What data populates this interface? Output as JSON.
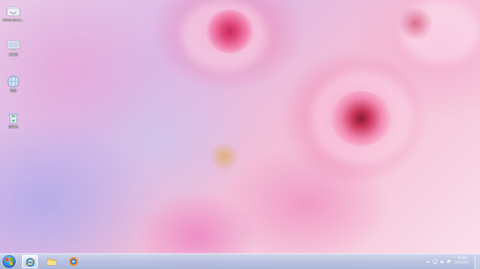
{
  "desktop": {
    "icons": [
      {
        "label": "Administrat...",
        "icon": "user-folder-icon"
      },
      {
        "label": "计算机",
        "icon": "computer-icon"
      },
      {
        "label": "网络",
        "icon": "network-globe-icon"
      },
      {
        "label": "回收站",
        "icon": "recycle-bin-icon"
      }
    ]
  },
  "taskbar": {
    "start": {
      "icon": "windows-start-orb-icon"
    },
    "pinned": [
      {
        "name": "ie-browser",
        "icon": "internet-explorer-icon",
        "active": true
      },
      {
        "name": "file-explorer",
        "icon": "folder-icon",
        "active": false
      },
      {
        "name": "media-player",
        "icon": "media-player-icon",
        "active": false
      }
    ],
    "tray": {
      "icons": [
        "show-hidden-icons-arrow-icon",
        "network-status-icon",
        "volume-icon",
        "action-center-flag-icon"
      ]
    },
    "clock": {
      "time": "19:20",
      "date": "2012/3/3"
    }
  },
  "colors": {
    "taskbar": "#b4c3e1",
    "label_text": "#ffffff",
    "start_orb": "#3f86cf"
  }
}
